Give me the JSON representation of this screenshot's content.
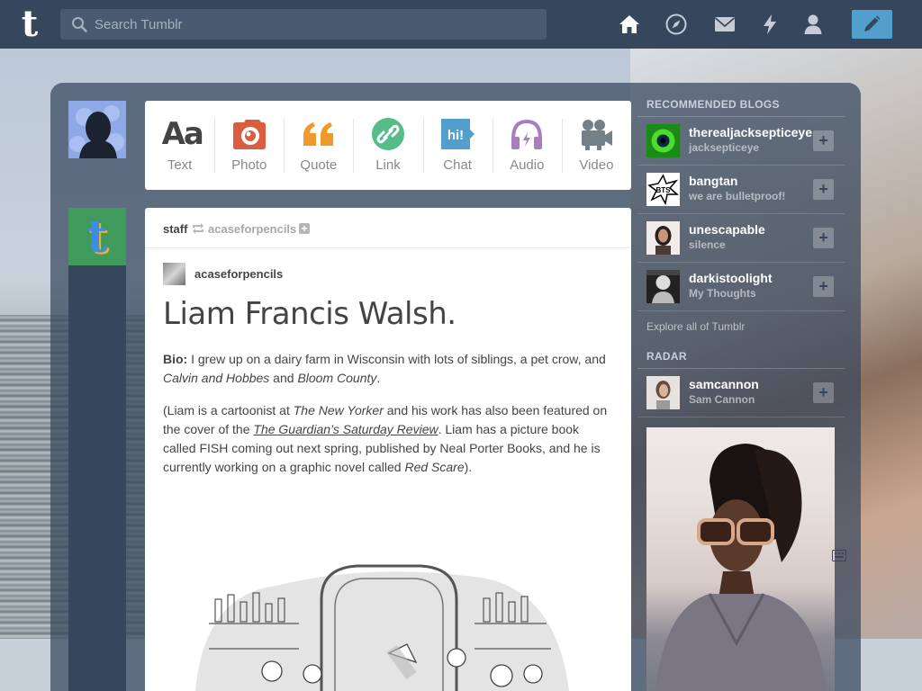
{
  "topbar": {
    "logo": "t",
    "search_placeholder": "Search Tumblr",
    "nav": [
      "home-icon",
      "explore-icon",
      "inbox-icon",
      "activity-icon",
      "account-icon"
    ],
    "compose": "pencil-icon"
  },
  "post_types": [
    {
      "label": "Text",
      "icon": "text-icon",
      "glyph": "Aa",
      "color": "#444444"
    },
    {
      "label": "Photo",
      "icon": "camera-icon",
      "color": "#d95e40"
    },
    {
      "label": "Quote",
      "icon": "quote-icon",
      "color": "#f2992e"
    },
    {
      "label": "Link",
      "icon": "link-icon",
      "color": "#56bc8a"
    },
    {
      "label": "Chat",
      "icon": "chat-icon",
      "glyph": "hi!",
      "color": "#529ecc"
    },
    {
      "label": "Audio",
      "icon": "headphones-icon",
      "color": "#a77dc2"
    },
    {
      "label": "Video",
      "icon": "video-camera-icon",
      "color": "#748089"
    }
  ],
  "post": {
    "author": "staff",
    "reblogged_from": "acaseforpencils",
    "source_name": "acaseforpencils",
    "title": "Liam Francis Walsh.",
    "bio_label": "Bio:",
    "bio_text_1": " I grew up on a dairy farm in Wisconsin with lots of siblings, a pet crow, and ",
    "bio_italic_1": "Calvin and Hobbes",
    "bio_text_2": " and ",
    "bio_italic_2": "Bloom County",
    "bio_text_3": ".",
    "p2_text_1": "(Liam is a cartoonist at ",
    "p2_italic_1": "The New Yorker",
    "p2_text_2": " and his work has also been featured on the cover of the ",
    "p2_link": "The Guardian’s Saturday Review",
    "p2_text_3": ". Liam has a picture book called FISH coming out next spring, published by Neal Porter Books, and he is currently working on a graphic novel called ",
    "p2_italic_2": "Red Scare",
    "p2_text_4": ")."
  },
  "sidebar": {
    "recommended_heading": "RECOMMENDED BLOGS",
    "recommended": [
      {
        "name": "therealjacksepticeye",
        "title": "jacksepticeye"
      },
      {
        "name": "bangtan",
        "title": "we are bulletproof!"
      },
      {
        "name": "unescapable",
        "title": "silence"
      },
      {
        "name": "darkistoolight",
        "title": "My Thoughts"
      }
    ],
    "explore_link": "Explore all of Tumblr",
    "radar_heading": "RADAR",
    "radar": {
      "name": "samcannon",
      "title": "Sam Cannon"
    },
    "follow_symbol": "+"
  }
}
